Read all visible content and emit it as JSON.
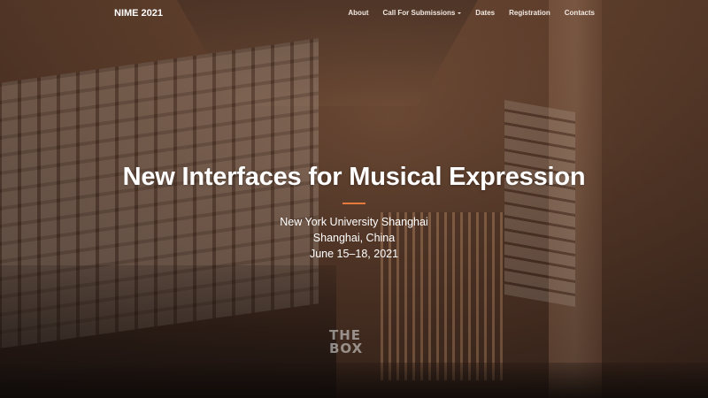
{
  "navbar": {
    "brand": "NIME 2021",
    "items": [
      {
        "label": "About",
        "has_dropdown": false
      },
      {
        "label": "Call For Submissions",
        "has_dropdown": true
      },
      {
        "label": "Dates",
        "has_dropdown": false
      },
      {
        "label": "Registration",
        "has_dropdown": false
      },
      {
        "label": "Contacts",
        "has_dropdown": false
      }
    ]
  },
  "hero": {
    "title": "New Interfaces for Musical Expression",
    "venue": "New York University Shanghai",
    "location": "Shanghai, China",
    "dates": "June 15–18, 2021",
    "background_sign": "THE\nBOX"
  },
  "colors": {
    "accent": "#e57b3a",
    "overlay": "#5f3e2a",
    "text": "#ffffff"
  },
  "icons": {
    "dropdown": "chevron-down-icon"
  }
}
